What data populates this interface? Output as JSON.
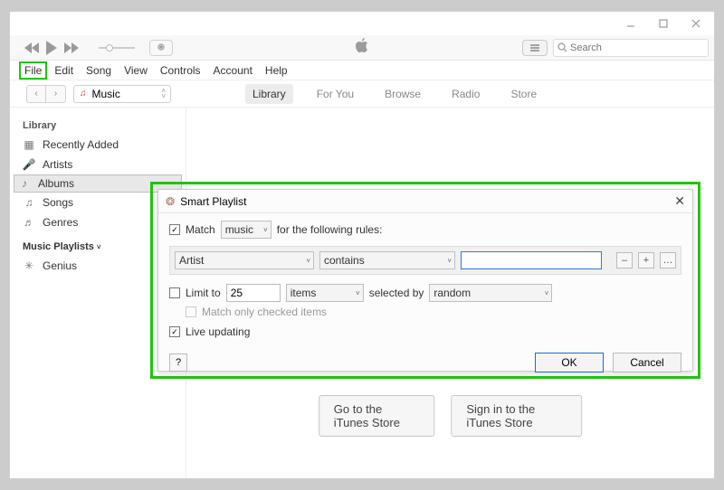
{
  "menubar": [
    "File",
    "Edit",
    "Song",
    "View",
    "Controls",
    "Account",
    "Help"
  ],
  "search": {
    "placeholder": "Search"
  },
  "media_selector": {
    "label": "Music"
  },
  "tabs": [
    "Library",
    "For You",
    "Browse",
    "Radio",
    "Store"
  ],
  "active_tab": "Library",
  "sidebar": {
    "library_header": "Library",
    "items": [
      {
        "icon": "grid",
        "label": "Recently Added"
      },
      {
        "icon": "mic",
        "label": "Artists"
      },
      {
        "icon": "note",
        "label": "Albums",
        "selected": true
      },
      {
        "icon": "note",
        "label": "Songs"
      },
      {
        "icon": "guitar",
        "label": "Genres"
      }
    ],
    "playlists_header": "Music Playlists",
    "playlists": [
      {
        "icon": "atom",
        "label": "Genius"
      }
    ]
  },
  "store_buttons": {
    "go": "Go to the iTunes Store",
    "signin": "Sign in to the iTunes Store"
  },
  "dialog": {
    "title": "Smart Playlist",
    "match_checked": true,
    "match_label_pre": "Match",
    "match_select": "music",
    "match_label_post": "for the following rules:",
    "rule": {
      "field": "Artist",
      "op": "contains",
      "value": ""
    },
    "limit": {
      "checked": false,
      "label": "Limit to",
      "value": "25",
      "unit": "items",
      "selected_by_label": "selected by",
      "selected_by": "random"
    },
    "match_only_checked": {
      "checked": false,
      "label": "Match only checked items"
    },
    "live_updating": {
      "checked": true,
      "label": "Live updating"
    },
    "help": "?",
    "ok": "OK",
    "cancel": "Cancel"
  }
}
